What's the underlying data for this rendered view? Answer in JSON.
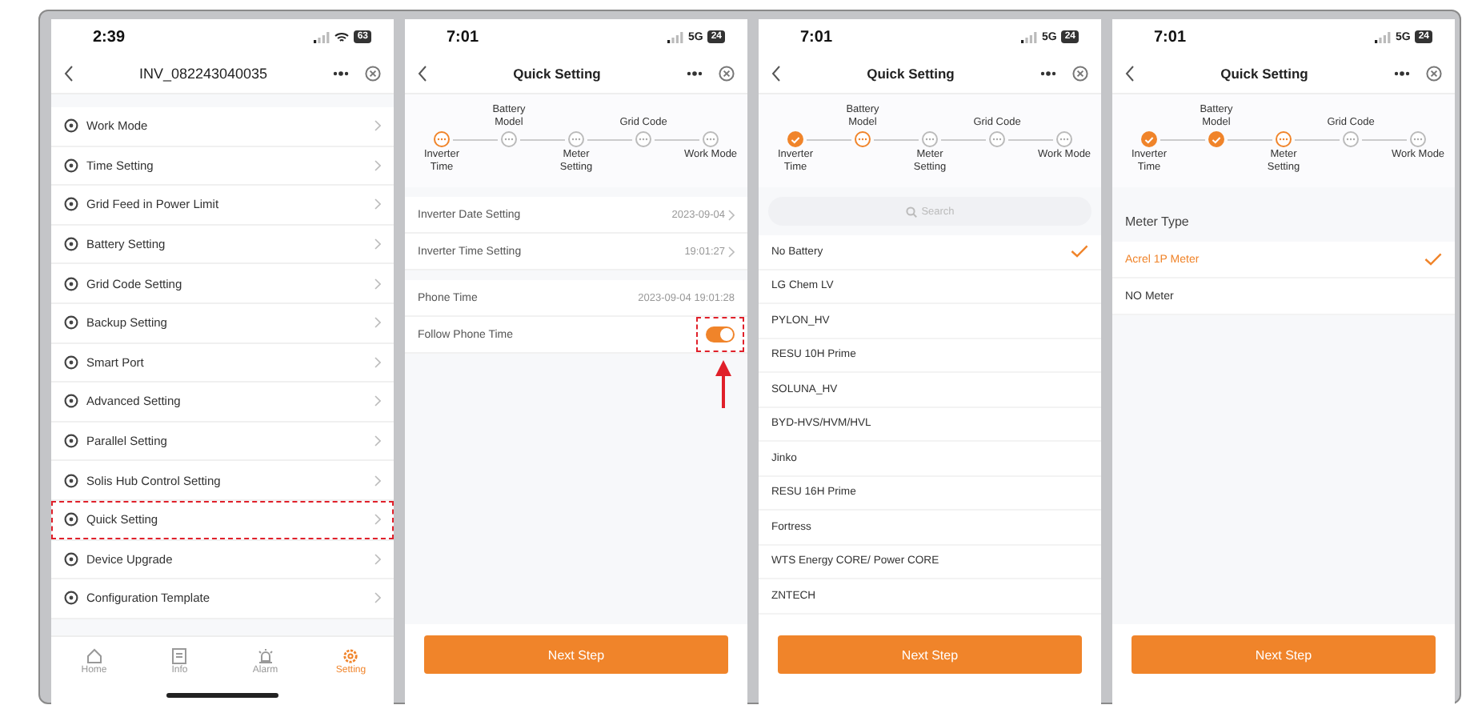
{
  "screens": [
    {
      "kind": "menu",
      "status": {
        "time": "2:39",
        "wifi": true,
        "battery": "63"
      },
      "title": "INV_082243040035",
      "items": [
        {
          "label": "Work Mode",
          "highlighted": false
        },
        {
          "label": "Time Setting",
          "highlighted": false
        },
        {
          "label": "Grid Feed in Power Limit",
          "highlighted": false
        },
        {
          "label": "Battery Setting",
          "highlighted": false
        },
        {
          "label": "Grid Code Setting",
          "highlighted": false
        },
        {
          "label": "Backup Setting",
          "highlighted": false
        },
        {
          "label": "Smart Port",
          "highlighted": false
        },
        {
          "label": "Advanced Setting",
          "highlighted": false
        },
        {
          "label": "Parallel Setting",
          "highlighted": false
        },
        {
          "label": "Solis Hub Control Setting",
          "highlighted": false
        },
        {
          "label": "Quick Setting",
          "highlighted": true
        },
        {
          "label": "Device Upgrade",
          "highlighted": false
        },
        {
          "label": "Configuration Template",
          "highlighted": false
        }
      ],
      "tabbar": [
        {
          "label": "Home",
          "kind": "home",
          "selected": false
        },
        {
          "label": "Info",
          "kind": "info",
          "selected": false
        },
        {
          "label": "Alarm",
          "kind": "alarm",
          "selected": false
        },
        {
          "label": "Setting",
          "kind": "setting",
          "selected": true
        }
      ]
    },
    {
      "kind": "time",
      "status": {
        "time": "7:01",
        "network": "5G",
        "battery": "24"
      },
      "title": "Quick Setting",
      "steps": [
        {
          "label": "Inverter Time",
          "done": false,
          "current": true
        },
        {
          "label": "Battery Model",
          "done": false,
          "current": false
        },
        {
          "label": "Meter Setting",
          "done": false,
          "current": false
        },
        {
          "label": "Grid Code",
          "done": false,
          "current": false
        },
        {
          "label": "Work Mode",
          "done": false,
          "current": false
        }
      ],
      "groups": [
        [
          {
            "kind": "link",
            "label": "Inverter Date Setting",
            "value": "2023-09-04"
          },
          {
            "kind": "link",
            "label": "Inverter Time Setting",
            "value": "19:01:27"
          }
        ],
        [
          {
            "kind": "text",
            "label": "Phone Time",
            "value": "2023-09-04 19:01:28"
          },
          {
            "kind": "toggle",
            "label": "Follow Phone Time",
            "on": true,
            "highlighted": true
          }
        ]
      ],
      "button": "Next Step"
    },
    {
      "kind": "list",
      "status": {
        "time": "7:01",
        "network": "5G",
        "battery": "24"
      },
      "title": "Quick Setting",
      "steps": [
        {
          "label": "Inverter Time",
          "done": true,
          "current": false
        },
        {
          "label": "Battery Model",
          "done": false,
          "current": true
        },
        {
          "label": "Meter Setting",
          "done": false,
          "current": false
        },
        {
          "label": "Grid Code",
          "done": false,
          "current": false
        },
        {
          "label": "Work Mode",
          "done": false,
          "current": false
        }
      ],
      "search": {
        "placeholder": "Search"
      },
      "options": [
        {
          "label": "No Battery",
          "selected": true
        },
        {
          "label": "LG Chem LV",
          "selected": false
        },
        {
          "label": "PYLON_HV",
          "selected": false
        },
        {
          "label": "RESU 10H Prime",
          "selected": false
        },
        {
          "label": "SOLUNA_HV",
          "selected": false
        },
        {
          "label": "BYD-HVS/HVM/HVL",
          "selected": false
        },
        {
          "label": "Jinko",
          "selected": false
        },
        {
          "label": "RESU 16H Prime",
          "selected": false
        },
        {
          "label": "Fortress",
          "selected": false
        },
        {
          "label": "WTS Energy CORE/ Power CORE",
          "selected": false
        },
        {
          "label": "ZNTECH",
          "selected": false
        }
      ],
      "button": "Next Step"
    },
    {
      "kind": "meter",
      "status": {
        "time": "7:01",
        "network": "5G",
        "battery": "24"
      },
      "title": "Quick Setting",
      "steps": [
        {
          "label": "Inverter Time",
          "done": true,
          "current": false
        },
        {
          "label": "Battery Model",
          "done": true,
          "current": false
        },
        {
          "label": "Meter Setting",
          "done": false,
          "current": true
        },
        {
          "label": "Grid Code",
          "done": false,
          "current": false
        },
        {
          "label": "Work Mode",
          "done": false,
          "current": false
        }
      ],
      "section": "Meter Type",
      "options": [
        {
          "label": "Acrel 1P Meter",
          "selected": true
        },
        {
          "label": "NO Meter",
          "selected": false
        }
      ],
      "button": "Next Step"
    }
  ]
}
